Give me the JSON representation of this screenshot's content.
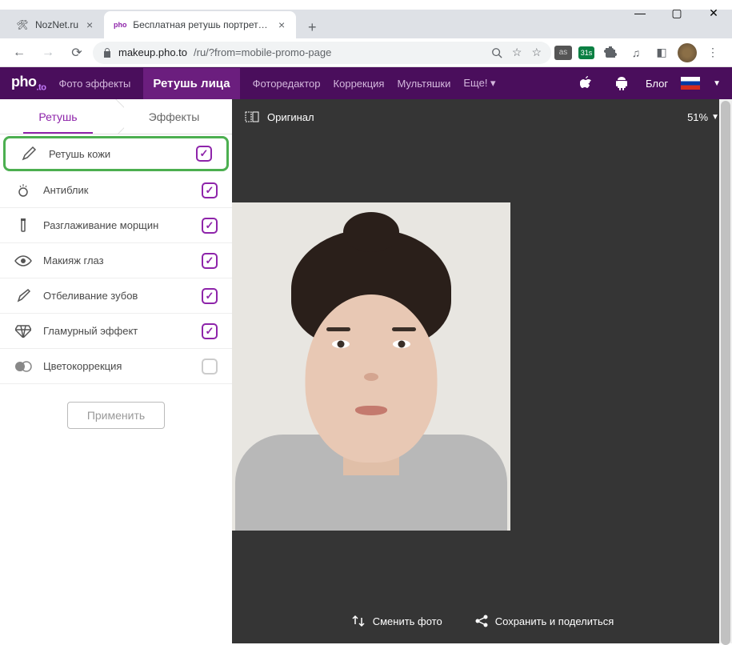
{
  "window": {
    "tabs": [
      {
        "title": "NozNet.ru",
        "favicon": "wrench"
      },
      {
        "title": "Бесплатная ретушь портретных",
        "favicon": "photo"
      }
    ]
  },
  "address": {
    "host": "makeup.pho.to",
    "path": "/ru/?from=mobile-promo-page",
    "ext_badge": "31s"
  },
  "site_nav": {
    "logo_main": "pho",
    "logo_sub": ".to",
    "items": [
      "Фото эффекты",
      "Ретушь лица",
      "Фоторедактор",
      "Коррекция",
      "Мультяшки",
      "Еще!"
    ],
    "active_index": 1,
    "blog": "Блог"
  },
  "sidebar": {
    "tabs": {
      "retouch": "Ретушь",
      "effects": "Эффекты"
    },
    "items": [
      {
        "label": "Ретушь кожи",
        "icon": "brush",
        "checked": true,
        "highlighted": true
      },
      {
        "label": "Антиблик",
        "icon": "shine",
        "checked": true
      },
      {
        "label": "Разглаживание морщин",
        "icon": "tube",
        "checked": true
      },
      {
        "label": "Макияж глаз",
        "icon": "eye",
        "checked": true
      },
      {
        "label": "Отбеливание зубов",
        "icon": "tooth",
        "checked": true
      },
      {
        "label": "Гламурный эффект",
        "icon": "diamond",
        "checked": true
      },
      {
        "label": "Цветокоррекция",
        "icon": "circles",
        "checked": false
      }
    ],
    "apply": "Применить"
  },
  "canvas": {
    "original": "Оригинал",
    "zoom": "51%",
    "change_photo": "Сменить фото",
    "save_share": "Сохранить и поделиться"
  }
}
